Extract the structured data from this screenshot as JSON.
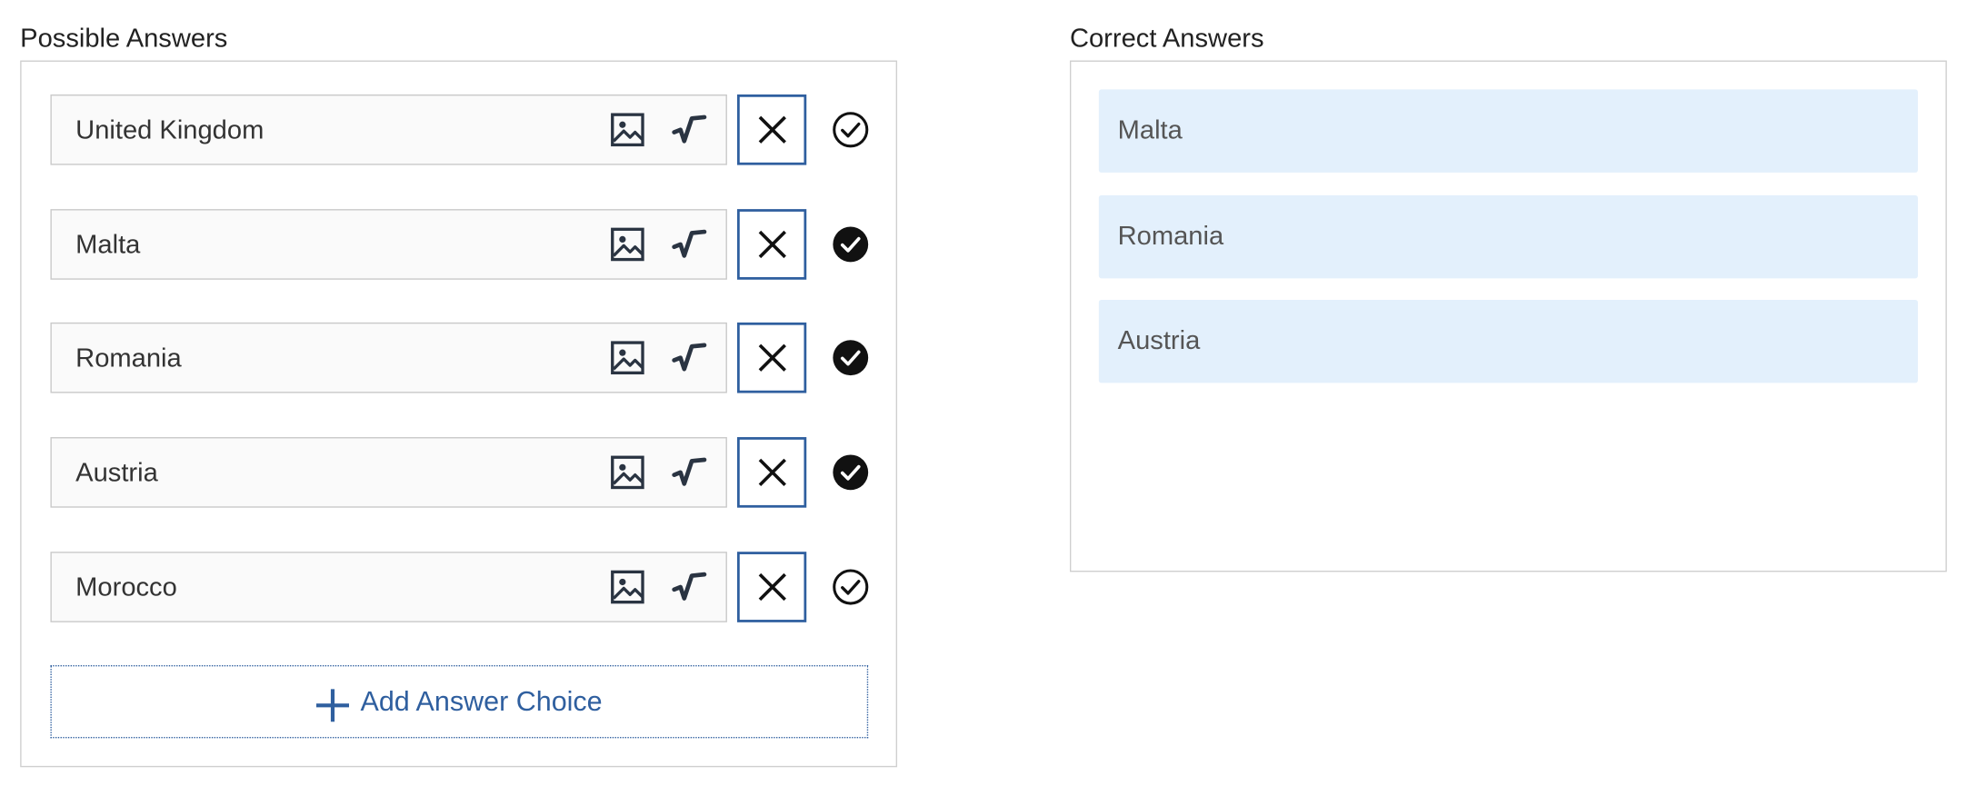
{
  "possible": {
    "title": "Possible Answers",
    "answers": [
      {
        "text": "United Kingdom",
        "correct": false
      },
      {
        "text": "Malta",
        "correct": true
      },
      {
        "text": "Romania",
        "correct": true
      },
      {
        "text": "Austria",
        "correct": true
      },
      {
        "text": "Morocco",
        "correct": false
      }
    ],
    "add_label": "Add Answer Choice"
  },
  "correct": {
    "title": "Correct Answers",
    "items": [
      "Malta",
      "Romania",
      "Austria"
    ]
  },
  "colors": {
    "accent": "#2f5f9f",
    "correct_bg": "#e3f0fc",
    "panel_border": "#cfcfcf",
    "input_bg": "#fafafa"
  },
  "icons": {
    "image": "image-icon",
    "formula": "square-root-icon",
    "remove": "close-icon",
    "mark_correct": "check-circle-icon",
    "add": "plus-icon"
  }
}
